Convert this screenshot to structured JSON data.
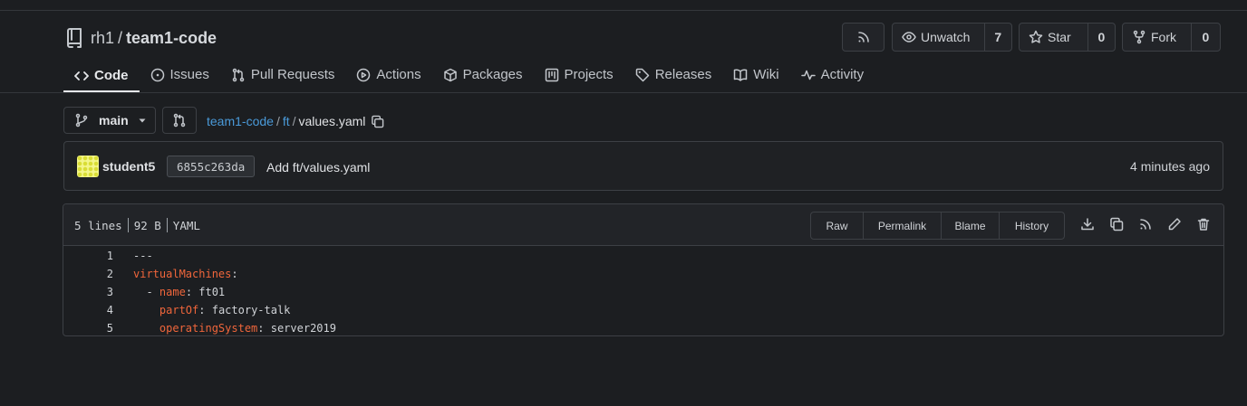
{
  "repo": {
    "owner": "rh1",
    "separator": "/",
    "name": "team1-code"
  },
  "header_buttons": {
    "unwatch_label": "Unwatch",
    "watch_count": "7",
    "star_label": "Star",
    "star_count": "0",
    "fork_label": "Fork",
    "fork_count": "0"
  },
  "tabs": [
    {
      "label": "Code",
      "icon": "code-icon",
      "active": true
    },
    {
      "label": "Issues",
      "icon": "issue-icon"
    },
    {
      "label": "Pull Requests",
      "icon": "pull-request-icon"
    },
    {
      "label": "Actions",
      "icon": "play-icon"
    },
    {
      "label": "Packages",
      "icon": "package-icon"
    },
    {
      "label": "Projects",
      "icon": "project-icon"
    },
    {
      "label": "Releases",
      "icon": "tag-icon"
    },
    {
      "label": "Wiki",
      "icon": "book-icon"
    },
    {
      "label": "Activity",
      "icon": "pulse-icon"
    }
  ],
  "branch": {
    "name": "main"
  },
  "breadcrumb": {
    "root": "team1-code",
    "dir": "ft",
    "sep": "/",
    "file": "values.yaml"
  },
  "commit": {
    "user": "student5",
    "sha": "6855c263da",
    "message": "Add ft/values.yaml",
    "time": "4 minutes ago"
  },
  "file": {
    "lines_label": "5 lines",
    "size": "92 B",
    "type": "YAML",
    "buttons": {
      "raw": "Raw",
      "permalink": "Permalink",
      "blame": "Blame",
      "history": "History"
    }
  },
  "code_lines": [
    {
      "num": "1",
      "indent": "",
      "key": "",
      "rest": "---"
    },
    {
      "num": "2",
      "indent": "",
      "key": "virtualMachines",
      "rest": ":"
    },
    {
      "num": "3",
      "indent": "  - ",
      "key": "name",
      "rest": ": ft01"
    },
    {
      "num": "4",
      "indent": "    ",
      "key": "partOf",
      "rest": ": factory-talk"
    },
    {
      "num": "5",
      "indent": "    ",
      "key": "operatingSystem",
      "rest": ": server2019"
    }
  ],
  "colors": {
    "background": "#1c1e21",
    "link": "#4a9ad9",
    "yaml_key": "#f0663b"
  }
}
